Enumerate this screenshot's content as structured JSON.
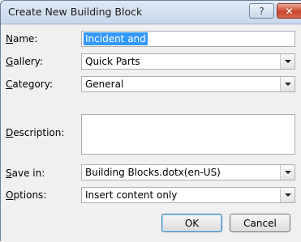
{
  "dialog": {
    "title": "Create New Building Block",
    "help_glyph": "?",
    "close_glyph": "✕"
  },
  "fields": {
    "name": {
      "label": "Name:",
      "accel": "N",
      "value": "Incident and"
    },
    "gallery": {
      "label": "Gallery:",
      "accel": "G",
      "value": "Quick Parts"
    },
    "category": {
      "label": "Category:",
      "accel": "C",
      "value": "General"
    },
    "description": {
      "label": "Description:",
      "accel": "D",
      "value": ""
    },
    "save_in": {
      "label": "Save in:",
      "accel": "S",
      "value": "Building Blocks.dotx(en-US)"
    },
    "options": {
      "label": "Options:",
      "accel": "O",
      "value": "Insert content only"
    }
  },
  "buttons": {
    "ok": "OK",
    "cancel": "Cancel"
  },
  "icons": {
    "dropdown": "chevron-down-icon",
    "help": "help-icon",
    "close": "close-icon"
  }
}
